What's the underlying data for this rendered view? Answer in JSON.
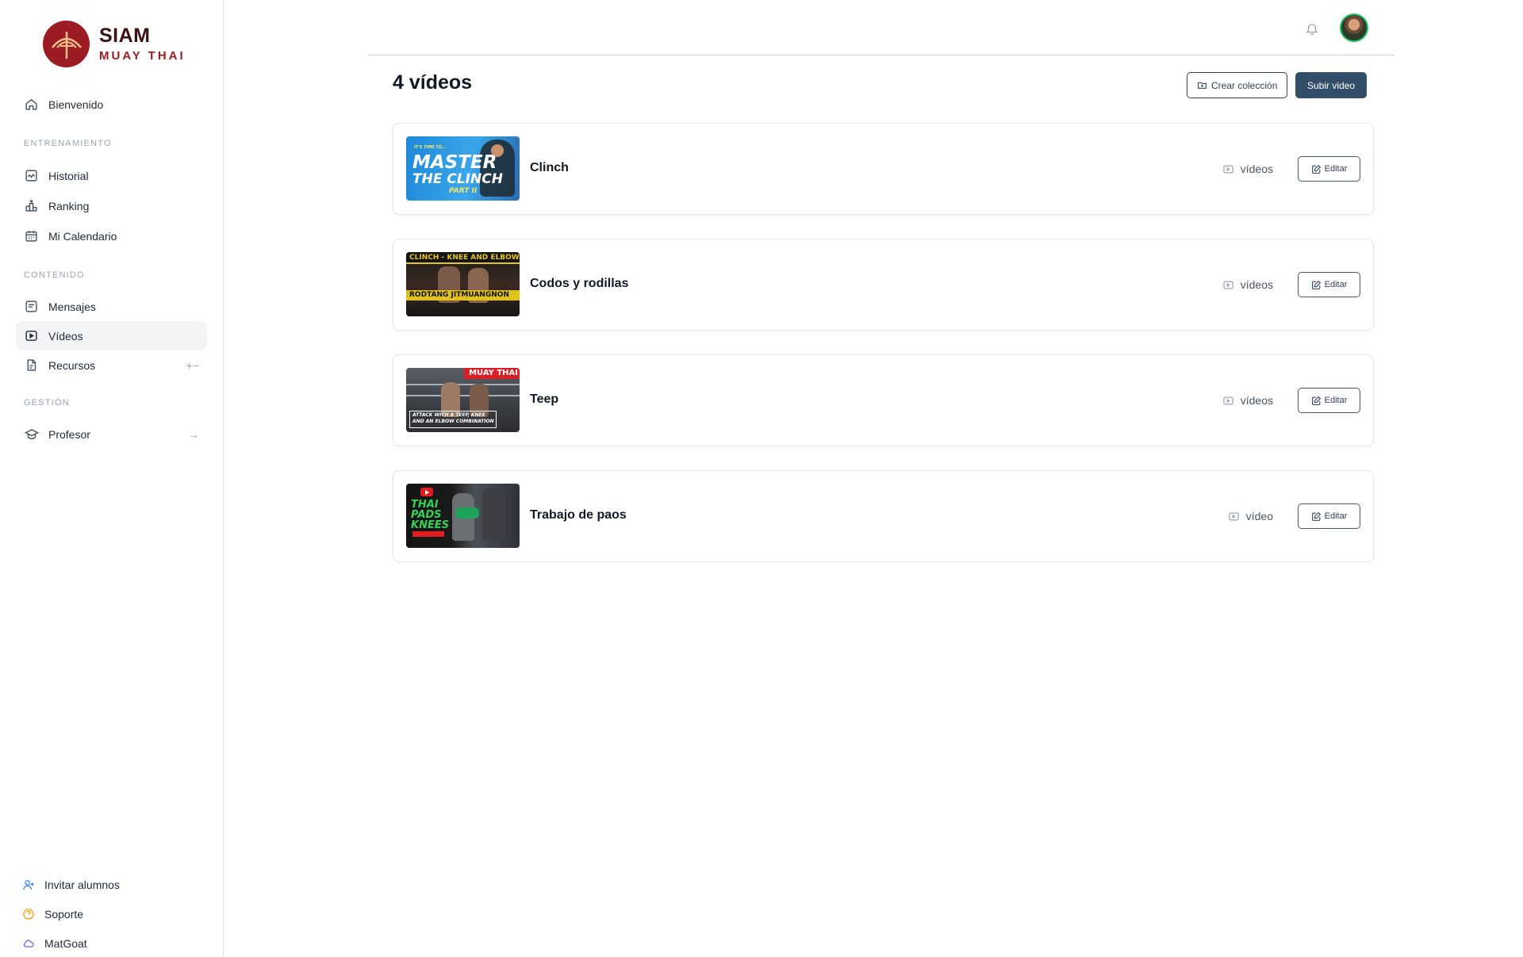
{
  "brand": {
    "title": "SIAM",
    "subtitle": "MUAY THAI"
  },
  "sidebar": {
    "home": {
      "label": "Bienvenido",
      "icon": "home-icon"
    },
    "sections": [
      {
        "label": "ENTRENAMIENTO"
      },
      {
        "label": "CONTENIDO"
      },
      {
        "label": "GESTIÓN"
      }
    ],
    "training": [
      {
        "label": "Historial",
        "icon": "activity-icon"
      },
      {
        "label": "Ranking",
        "icon": "podium-icon"
      },
      {
        "label": "Mi Calendario",
        "icon": "calendar-icon"
      }
    ],
    "content": [
      {
        "label": "Mensajes",
        "icon": "message-icon"
      },
      {
        "label": "Vídeos",
        "icon": "video-icon",
        "active": true
      },
      {
        "label": "Recursos",
        "icon": "file-icon",
        "trail": "+−"
      }
    ],
    "management": [
      {
        "label": "Profesor",
        "icon": "graduation-cap-icon",
        "trail": "→"
      }
    ],
    "footer": [
      {
        "label": "Invitar alumnos",
        "icon": "user-plus-icon",
        "color": "#3b82f6"
      },
      {
        "label": "Soporte",
        "icon": "help-circle-icon",
        "color": "#f59e0b"
      },
      {
        "label": "MatGoat",
        "icon": "cloud-icon",
        "color": "#6366f1"
      }
    ]
  },
  "header": {
    "title": "4 vídeos"
  },
  "actions": {
    "create_collection": "Crear colección",
    "upload_video": "Subir video"
  },
  "collections": [
    {
      "title": "Clinch",
      "count_label": "vídeos",
      "edit": "Editar",
      "thumb_text": [
        "IT'S TIME TO...",
        "MASTER",
        "THE CLINCH",
        "PART II"
      ]
    },
    {
      "title": "Codos y rodillas",
      "count_label": "vídeos",
      "edit": "Editar",
      "thumb_text": [
        "CLINCH - KNEE AND ELBOW",
        "RODTANG JITMUANGNON"
      ]
    },
    {
      "title": "Teep",
      "count_label": "vídeos",
      "edit": "Editar",
      "thumb_text": [
        "MUAY THAI",
        "ATTACK WITH A TEEP, KNEE",
        "AND AN ELBOW COMBINATION"
      ]
    },
    {
      "title": "Trabajo de paos",
      "count_label": "vídeo",
      "edit": "Editar",
      "thumb_text": [
        "THAI",
        "PADS",
        "KNEES"
      ]
    }
  ],
  "colors": {
    "brand": "#9b1c24",
    "primary": "#334e68",
    "active_bg": "#f3f4f6"
  }
}
